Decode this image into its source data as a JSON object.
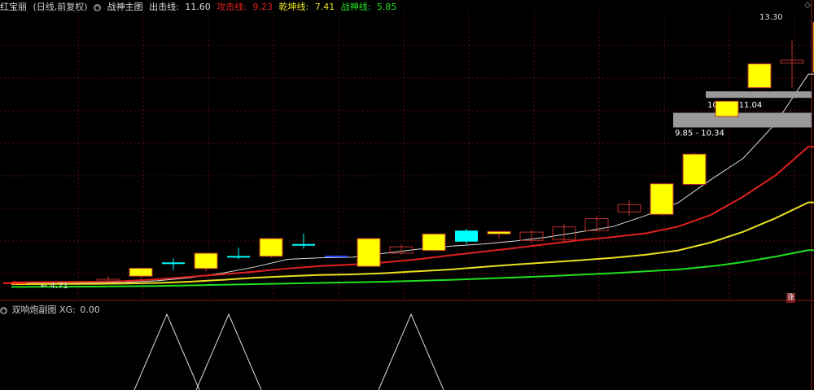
{
  "header": {
    "stock_name": "红宝丽",
    "period": "(日线,前复权)",
    "indicator_name": "战神主图",
    "lines": [
      {
        "label": "出击线",
        "value": "11.60",
        "color": "#dddddd"
      },
      {
        "label": "攻击线",
        "value": "9.23",
        "color": "#e02020"
      },
      {
        "label": "乾坤线",
        "value": "7.41",
        "color": "#e8e020"
      },
      {
        "label": "战神线",
        "value": "5.85",
        "color": "#20e020"
      }
    ]
  },
  "sub": {
    "indicator_name": "双响炮副图",
    "label": "XG:",
    "value": "0.00"
  },
  "badge": "涨",
  "chart_data": {
    "type": "candlestick",
    "y_range": [
      4.5,
      13.6
    ],
    "labels": {
      "high": "13.30",
      "low": "4.71"
    },
    "zones": [
      {
        "label": "10.84 - 11.04",
        "low": 10.84,
        "high": 11.04
      },
      {
        "label": "9.85 - 10.34",
        "low": 9.85,
        "high": 10.34
      }
    ],
    "candles": [
      {
        "o": 4.8,
        "h": 4.84,
        "l": 4.71,
        "c": 4.78,
        "style": "red"
      },
      {
        "o": 4.9,
        "h": 5.02,
        "l": 4.84,
        "c": 4.84,
        "style": "redhollow"
      },
      {
        "o": 5.0,
        "h": 5.04,
        "l": 4.92,
        "c": 5.26,
        "style": "yellow"
      },
      {
        "o": 5.45,
        "h": 5.58,
        "l": 5.2,
        "c": 5.4,
        "style": "cyan"
      },
      {
        "o": 5.25,
        "h": 5.32,
        "l": 5.16,
        "c": 5.75,
        "style": "yellow"
      },
      {
        "o": 5.66,
        "h": 5.94,
        "l": 5.55,
        "c": 5.62,
        "style": "cyan"
      },
      {
        "o": 5.65,
        "h": 5.7,
        "l": 5.6,
        "c": 6.23,
        "style": "yellow"
      },
      {
        "o": 6.05,
        "h": 6.4,
        "l": 5.9,
        "c": 6.0,
        "style": "cyan"
      },
      {
        "o": 5.67,
        "h": 5.68,
        "l": 5.65,
        "c": 5.66,
        "style": "blue"
      },
      {
        "o": 5.32,
        "h": 5.35,
        "l": 5.3,
        "c": 6.23,
        "style": "yellow"
      },
      {
        "o": 5.75,
        "h": 6.04,
        "l": 5.7,
        "c": 5.96,
        "style": "redhollow"
      },
      {
        "o": 5.84,
        "h": 5.88,
        "l": 5.84,
        "c": 6.38,
        "style": "yellow"
      },
      {
        "o": 6.13,
        "h": 6.55,
        "l": 6.05,
        "c": 6.49,
        "style": "cyan"
      },
      {
        "o": 6.38,
        "h": 6.49,
        "l": 6.23,
        "c": 6.46,
        "style": "yellow"
      },
      {
        "o": 6.17,
        "h": 6.52,
        "l": 6.05,
        "c": 6.44,
        "style": "redhollow"
      },
      {
        "o": 6.2,
        "h": 6.71,
        "l": 6.08,
        "c": 6.61,
        "style": "redhollow"
      },
      {
        "o": 6.49,
        "h": 6.96,
        "l": 6.46,
        "c": 6.88,
        "style": "redhollow"
      },
      {
        "o": 7.1,
        "h": 7.5,
        "l": 6.96,
        "c": 7.34,
        "style": "redhollow"
      },
      {
        "o": 7.02,
        "h": 7.32,
        "l": 6.96,
        "c": 8.02,
        "style": "yellow"
      },
      {
        "o": 8.0,
        "h": 9.04,
        "l": 8.0,
        "c": 8.99,
        "style": "yellow"
      },
      {
        "o": 10.22,
        "h": 10.34,
        "l": 10.22,
        "c": 10.72,
        "style": "yellow"
      },
      {
        "o": 11.16,
        "h": 11.94,
        "l": 11.16,
        "c": 11.94,
        "style": "yellow"
      },
      {
        "o": 11.97,
        "h": 12.7,
        "l": 11.16,
        "c": 12.06,
        "style": "redhollow"
      },
      {
        "o": 11.66,
        "h": 13.3,
        "l": 11.66,
        "c": 13.3,
        "style": "yellow"
      }
    ],
    "ma_lines": [
      {
        "name": "出击线",
        "color": "#dddddd",
        "values": [
          4.76,
          4.78,
          4.8,
          4.85,
          4.95,
          5.1,
          5.3,
          5.55,
          5.6,
          5.62,
          5.75,
          5.88,
          5.98,
          6.05,
          6.15,
          6.28,
          6.45,
          6.62,
          6.98,
          7.4,
          8.15,
          8.85,
          10.0,
          11.6
        ]
      },
      {
        "name": "攻击线",
        "color": "#e02020",
        "values": [
          4.8,
          4.82,
          4.84,
          4.9,
          4.98,
          5.06,
          5.15,
          5.25,
          5.33,
          5.38,
          5.45,
          5.55,
          5.68,
          5.8,
          5.92,
          6.05,
          6.18,
          6.28,
          6.4,
          6.62,
          7.0,
          7.6,
          8.3,
          9.23
        ]
      },
      {
        "name": "乾坤线",
        "color": "#e8e020",
        "values": [
          4.74,
          4.75,
          4.76,
          4.78,
          4.82,
          4.88,
          4.95,
          5.0,
          5.04,
          5.06,
          5.1,
          5.16,
          5.22,
          5.3,
          5.38,
          5.45,
          5.52,
          5.6,
          5.7,
          5.84,
          6.1,
          6.45,
          6.9,
          7.41
        ]
      },
      {
        "name": "战神线",
        "color": "#20e020",
        "values": [
          4.65,
          4.66,
          4.67,
          4.68,
          4.7,
          4.72,
          4.74,
          4.76,
          4.78,
          4.8,
          4.82,
          4.85,
          4.88,
          4.92,
          4.96,
          5.0,
          5.05,
          5.1,
          5.16,
          5.22,
          5.32,
          5.46,
          5.64,
          5.85
        ]
      }
    ],
    "sub_peaks": [
      {
        "center_index": 3.8
      },
      {
        "center_index": 5.7
      },
      {
        "center_index": 11.3
      }
    ]
  }
}
